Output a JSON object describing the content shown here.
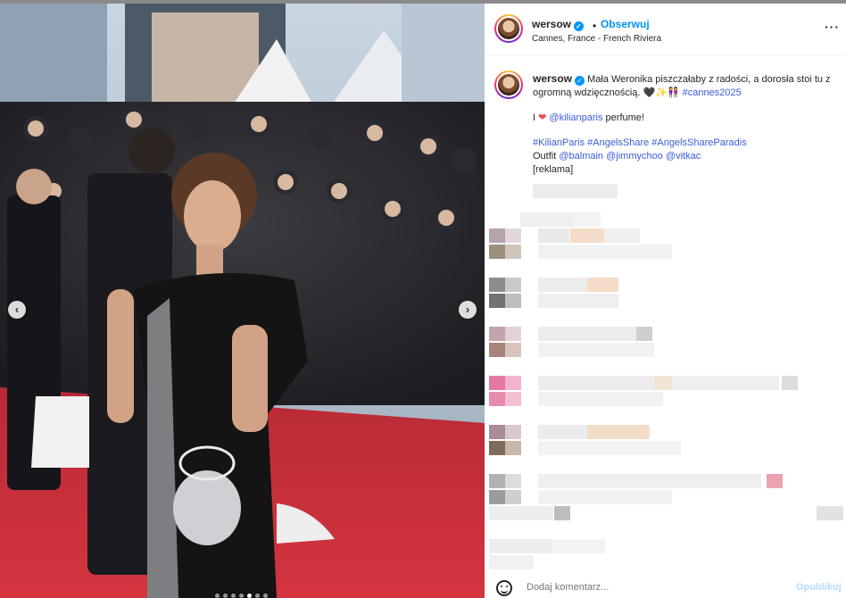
{
  "post": {
    "username": "wersow",
    "follow_label": "Obserwuj",
    "separator": "•",
    "location": "Cannes, France - French Riviera",
    "more_label": "···",
    "verified_glyph": "✓"
  },
  "caption": {
    "line1": "Mała Weronika piszczałaby z radości, a dorosła stoi tu z ogromną wdzięcznością. 🖤✨👭",
    "hashtag_cannes": "#cannes2025",
    "perfume_prefix": "I",
    "heart": "❤",
    "mention_kilian": "@kilianparis",
    "perfume_suffix": "perfume!",
    "hashtags": "#KilianParis #AngelsShare #AngelsShareParadis",
    "outfit_label": "Outfit",
    "mention_balmain": "@balmain",
    "mention_jimmychoo": "@jimmychoo",
    "mention_vitkac": "@vitkac",
    "ad_label": "[reklama]"
  },
  "media": {
    "prev_label": "‹",
    "next_label": "›",
    "slides": 7,
    "active_slide": 4,
    "icons": [
      "chevron-left-icon",
      "chevron-right-icon"
    ]
  },
  "comment_bar": {
    "placeholder": "Dodaj komentarz...",
    "publish_label": "Opublikuj",
    "emoji_icon": "smiley-icon"
  },
  "colors": {
    "accent": "#0095f6",
    "link": "#3b5bdb",
    "carpet": "#c8323c",
    "dress": "#141414"
  }
}
